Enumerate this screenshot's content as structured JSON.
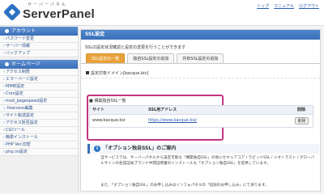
{
  "header": {
    "logo_sub": "サーバーパネル",
    "logo_text": "ServerPanel",
    "links": [
      "トップ",
      "マニュアル",
      "ログアウト"
    ]
  },
  "sidebar": {
    "account_head": "アカウント",
    "account_items": [
      "パスワード変更",
      "サーバー情報",
      "バックアップ"
    ],
    "home_head": "ホームページ",
    "home_items": [
      "アクセス制限",
      "エラーページ設定",
      "MIME設定",
      "Cron設定",
      "mod_pagespeed設定",
      ".htaccess編集",
      "サイト転送設定",
      "アクセス拒否設定",
      "CGIツール",
      "簡単インストール",
      "PHP Ver.切替",
      "php.ini設定"
    ]
  },
  "main": {
    "title": "SSL設定",
    "desc": "SSLの設定状況確認と設定の変更を行うことができます",
    "tabs": [
      "SSL設定の一覧",
      "独自SSL設定の追加",
      "共有SSL設定の追加"
    ],
    "domain_line": "設定対象ドメイン[bacque.biz]",
    "list_title": "■ 構築独自SSL一覧",
    "table": {
      "headers": [
        "サイト",
        "SSL用アドレス",
        "削除"
      ],
      "rows": [
        {
          "site": "www.bacque.biz",
          "address": "https://www.bacque.biz/",
          "action": "削除"
        }
      ]
    },
    "info": {
      "title": "「オプション独自SSL」のご案内",
      "body": "当サービスでは、サーバーパネルから設定可能な「構築独自SSL」の他にセキュアコア / ラピッドSSL / ジオトラスト / グローバルサインの各認証局ブランド中間証明書のインストールも「オプション独自SSL」を提供しています。",
      "foot": "また、「オプション独自SSL」のお申し込みはインフォパネルの「追加のお申し込み」にて承ります。"
    }
  }
}
